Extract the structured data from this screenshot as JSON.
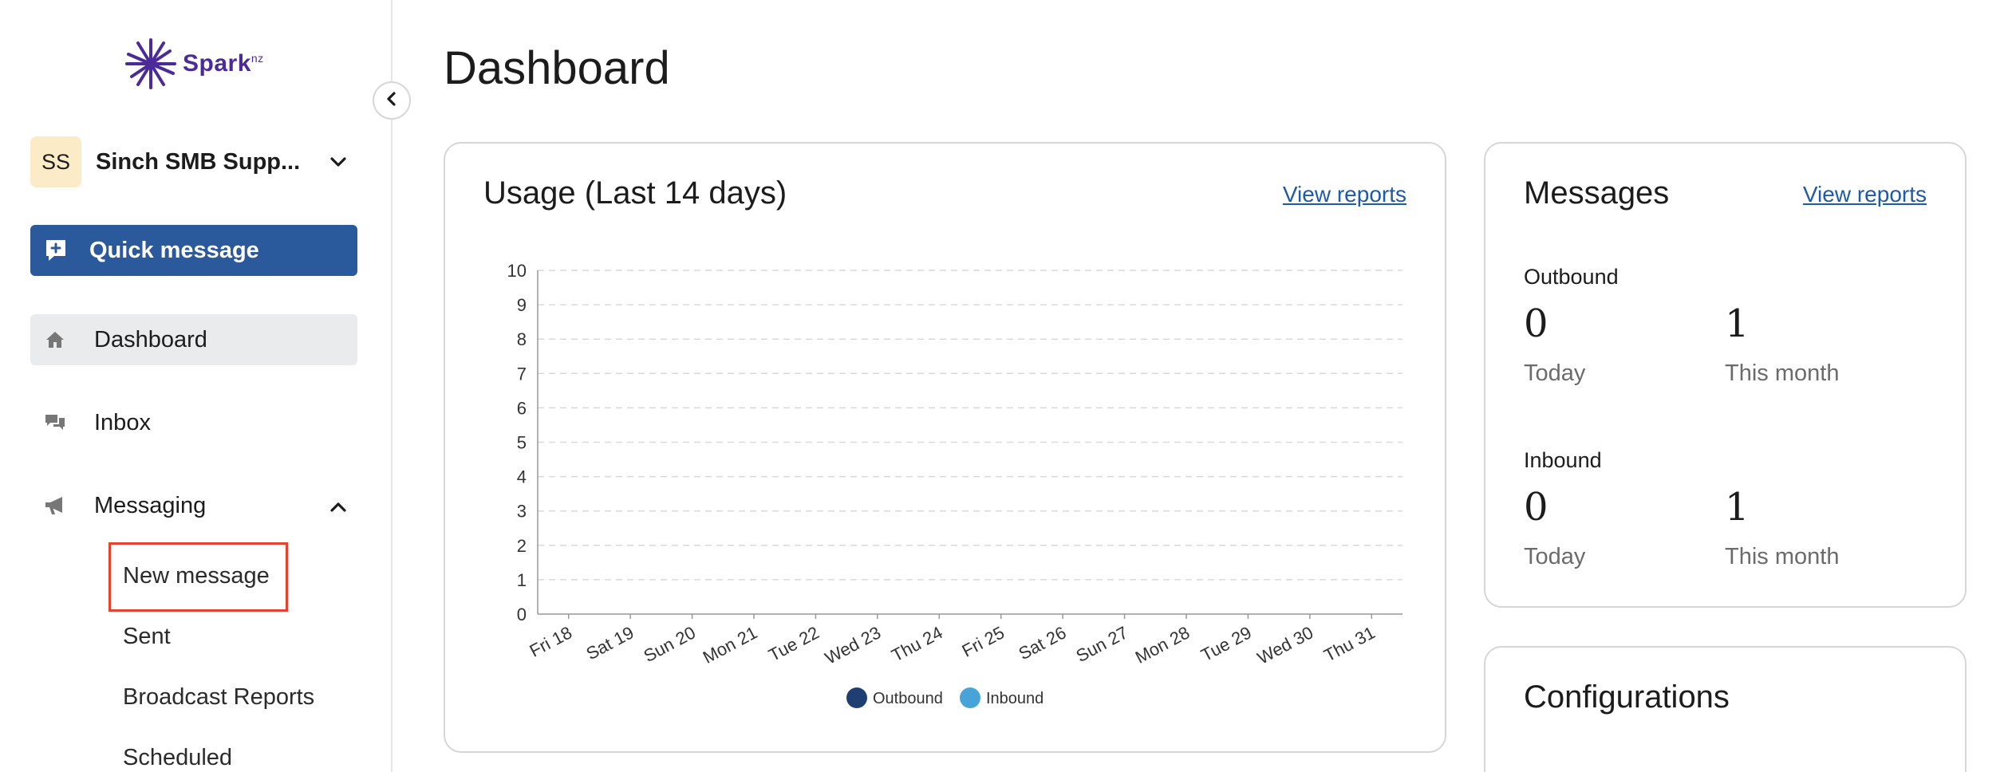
{
  "brand": {
    "name": "Spark",
    "superscript": "nz",
    "color": "#4b2a9a"
  },
  "sidebar": {
    "account": {
      "initials": "SS",
      "name": "Sinch SMB Supp..."
    },
    "quick_message": {
      "label": "Quick message",
      "icon": "add-message-icon"
    },
    "items": [
      {
        "label": "Dashboard",
        "icon": "home-icon",
        "active": true
      },
      {
        "label": "Inbox",
        "icon": "chat-bubbles-icon"
      },
      {
        "label": "Messaging",
        "icon": "megaphone-icon",
        "expanded": true
      }
    ],
    "messaging_sub": [
      "New message",
      "Sent",
      "Broadcast Reports",
      "Scheduled"
    ]
  },
  "page": {
    "title": "Dashboard"
  },
  "usage": {
    "title": "Usage (Last 14 days)",
    "link": "View reports"
  },
  "messages": {
    "title": "Messages",
    "link": "View reports",
    "outbound": {
      "label": "Outbound",
      "today": "0",
      "today_label": "Today",
      "month": "1",
      "month_label": "This month"
    },
    "inbound": {
      "label": "Inbound",
      "today": "0",
      "today_label": "Today",
      "month": "1",
      "month_label": "This month"
    }
  },
  "configurations": {
    "title": "Configurations"
  },
  "chart_data": {
    "type": "bar",
    "categories": [
      "Fri 18",
      "Sat 19",
      "Sun 20",
      "Mon 21",
      "Tue 22",
      "Wed 23",
      "Thu 24",
      "Fri 25",
      "Sat 26",
      "Sun 27",
      "Mon 28",
      "Tue 29",
      "Wed 30",
      "Thu 31"
    ],
    "series": [
      {
        "name": "Outbound",
        "color": "#1f3f73",
        "values": [
          0,
          0,
          0,
          0,
          0,
          0,
          0,
          0,
          0,
          0,
          0,
          0,
          0,
          0
        ]
      },
      {
        "name": "Inbound",
        "color": "#48a4d8",
        "values": [
          0,
          0,
          0,
          0,
          0,
          0,
          0,
          0,
          0,
          0,
          0,
          0,
          0,
          0
        ]
      }
    ],
    "yticks": [
      "0",
      "1",
      "2",
      "3",
      "4",
      "5",
      "6",
      "7",
      "8",
      "9",
      "10"
    ],
    "ylim": [
      0,
      10
    ],
    "grid": true,
    "legend": "bottom-center"
  }
}
